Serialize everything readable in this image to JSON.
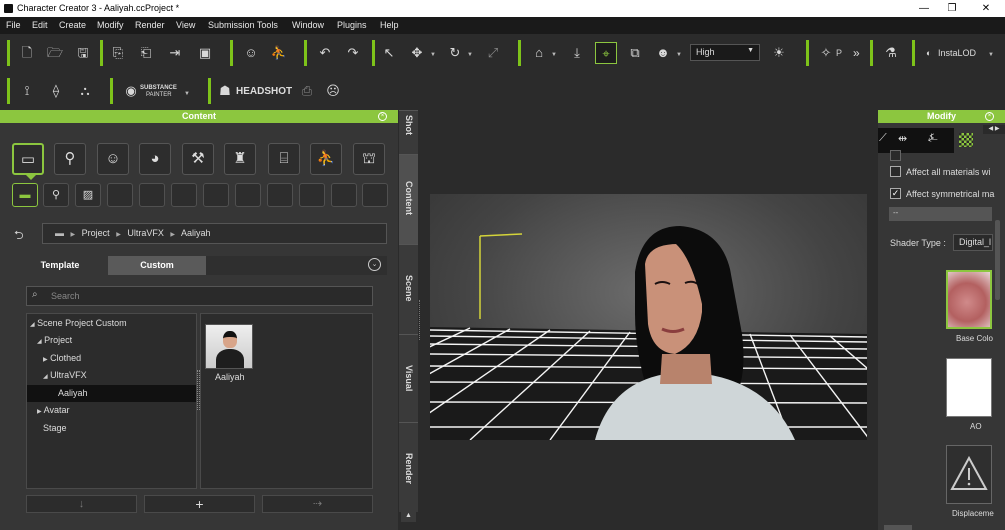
{
  "window": {
    "title": "Character Creator 3 - Aaliyah.ccProject *",
    "minimize": "—",
    "restore": "❐",
    "close": "✕"
  },
  "menu": [
    "File",
    "Edit",
    "Create",
    "Modify",
    "Render",
    "View",
    "Submission Tools",
    "Window",
    "Plugins",
    "Help"
  ],
  "toolbar": {
    "quality_value": "High",
    "quality_arrow": "▼",
    "substance_label": "SUBSTANCE",
    "substance_sub": "PAINTER",
    "headshot_label": "HEADSHOT",
    "instalod_label": "InstaLOD",
    "more": "»",
    "p_label": "P"
  },
  "content_panel": {
    "title": "Content",
    "breadcrumb": [
      "Project",
      "UltraVFX",
      "Aaliyah"
    ],
    "breadcrumb_sep": "▶",
    "tabs": [
      "Template",
      "Custom"
    ],
    "search_placeholder": "Search",
    "tree": [
      {
        "label": "Scene Project Custom",
        "arrow": "◢"
      },
      {
        "label": "Project",
        "arrow": "◢"
      },
      {
        "label": "Clothed",
        "arrow": "▶"
      },
      {
        "label": "UltraVFX",
        "arrow": "◢"
      },
      {
        "label": "Aaliyah",
        "arrow": ""
      },
      {
        "label": "Avatar",
        "arrow": "▶"
      },
      {
        "label": "Stage",
        "arrow": ""
      }
    ],
    "items": [
      {
        "label": "Aaliyah"
      }
    ],
    "bottom_buttons": {
      "down": "↓",
      "add": "+",
      "replace": "⇢"
    }
  },
  "side_tabs": [
    "Shot",
    "Content",
    "Scene",
    "Visual",
    "Render"
  ],
  "modify_panel": {
    "title": "Modify",
    "affect_all": "Affect all materials wi",
    "affect_symmetrical": "Affect symmetrical ma",
    "dropdown_value": "--",
    "shader_label": "Shader Type :",
    "shader_value": "Digital_l",
    "channels": [
      {
        "label": "Base Colo"
      },
      {
        "label": "AO"
      },
      {
        "label": "Displaceme"
      }
    ]
  },
  "colors": {
    "accent": "#8cc63f",
    "panel": "#363636",
    "bg": "#2b2b2b"
  }
}
